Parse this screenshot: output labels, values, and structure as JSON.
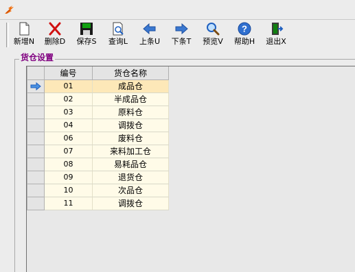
{
  "toolbar": {
    "buttons": [
      {
        "label": "新增N",
        "icon": "new-document-icon"
      },
      {
        "label": "删除D",
        "icon": "delete-x-icon"
      },
      {
        "label": "保存S",
        "icon": "save-disk-icon"
      },
      {
        "label": "查询L",
        "icon": "search-document-icon"
      },
      {
        "label": "上条U",
        "icon": "arrow-left-icon"
      },
      {
        "label": "下条T",
        "icon": "arrow-right-icon"
      },
      {
        "label": "预览V",
        "icon": "magnifier-icon"
      },
      {
        "label": "帮助H",
        "icon": "help-icon"
      },
      {
        "label": "退出X",
        "icon": "exit-door-icon"
      }
    ]
  },
  "panel": {
    "title": "货仓设置"
  },
  "grid": {
    "columns": [
      "编号",
      "货仓名称"
    ],
    "rows": [
      {
        "code": "01",
        "name": "成品仓"
      },
      {
        "code": "02",
        "name": "半成品仓"
      },
      {
        "code": "03",
        "name": "原料仓"
      },
      {
        "code": "04",
        "name": "调拨仓"
      },
      {
        "code": "06",
        "name": "废料仓"
      },
      {
        "code": "07",
        "name": "来料加工仓"
      },
      {
        "code": "08",
        "name": "易耗品仓"
      },
      {
        "code": "09",
        "name": "退货仓"
      },
      {
        "code": "10",
        "name": "次品仓"
      },
      {
        "code": "11",
        "name": "调拨仓"
      }
    ],
    "selected_row": 0
  },
  "colors": {
    "title_accent": "#800080",
    "row_background": "#fffbe8",
    "selected_row_background": "#fde8b8",
    "toolbar_red": "#d01010",
    "toolbar_green": "#108010",
    "toolbar_blue": "#1e5fbf"
  }
}
